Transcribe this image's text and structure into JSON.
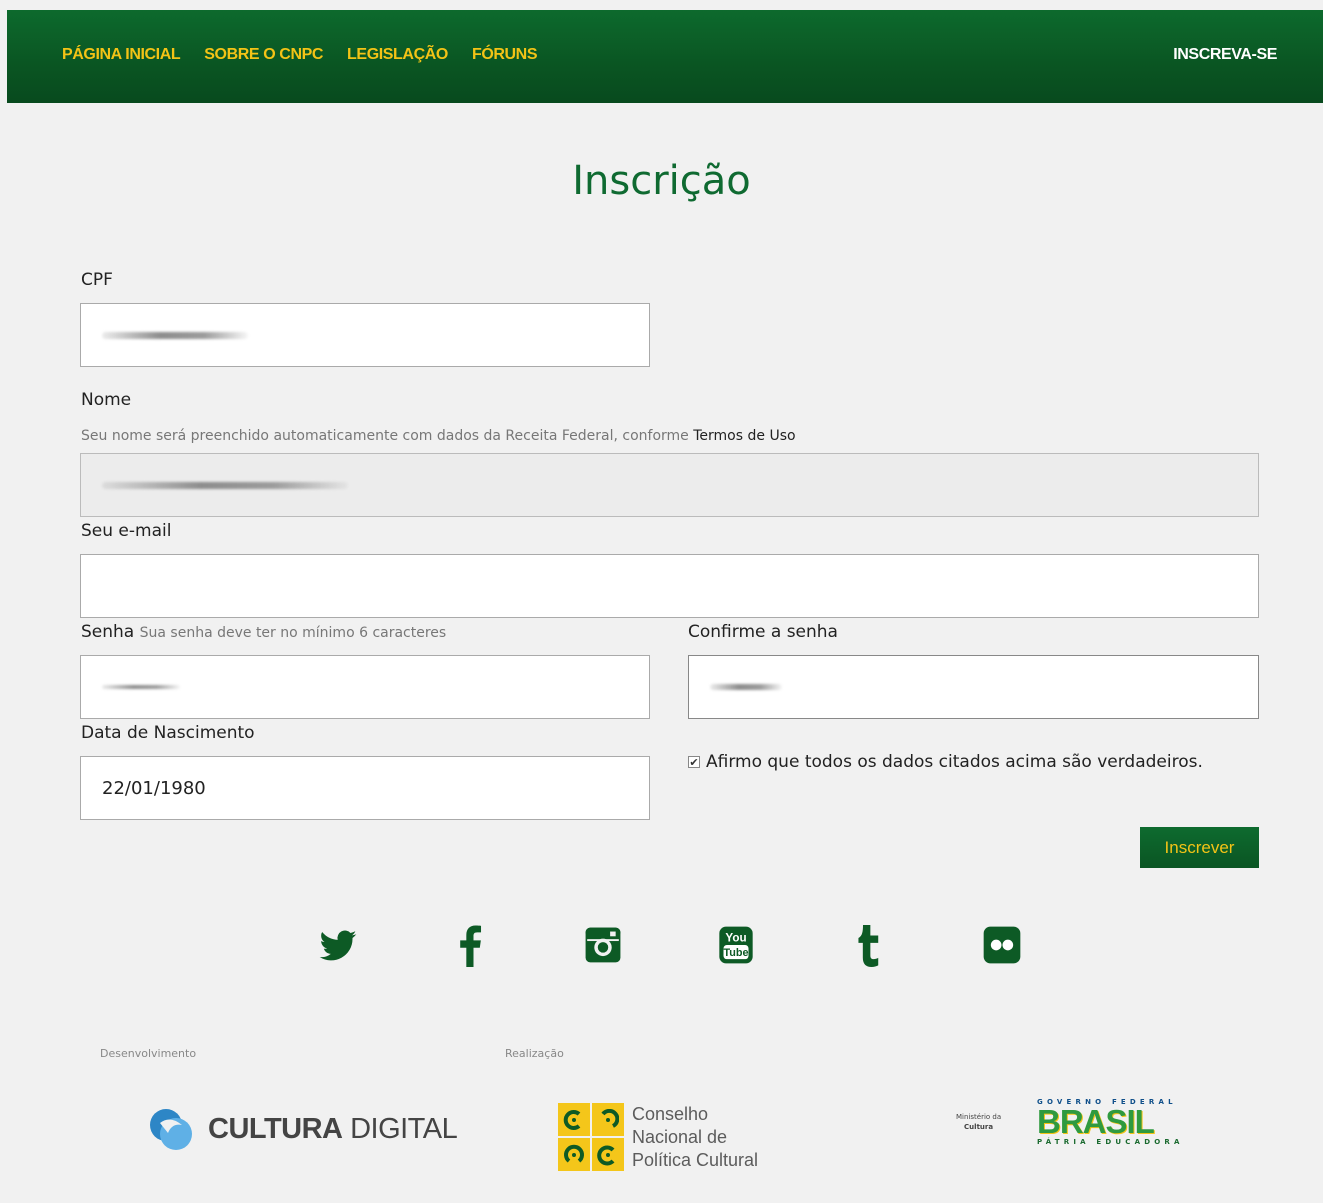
{
  "nav": {
    "items": [
      "PÁGINA INICIAL",
      "SOBRE O CNPC",
      "LEGISLAÇÃO",
      "FÓRUNS"
    ],
    "signup_label": "INSCREVA-SE"
  },
  "page": {
    "title": "Inscrição"
  },
  "form": {
    "cpf": {
      "label": "CPF",
      "value": "[redacted]"
    },
    "nome": {
      "label": "Nome",
      "hint": "Seu nome será preenchido automaticamente com dados da Receita Federal, conforme",
      "hint_link": "Termos de Uso",
      "value": "[redacted]"
    },
    "email": {
      "label": "Seu e-mail",
      "value": ""
    },
    "senha": {
      "label": "Senha",
      "hint": "Sua senha deve ter no mínimo 6 caracteres",
      "value": "[redacted]"
    },
    "confirm": {
      "label": "Confirme a senha",
      "value": "[redacted]"
    },
    "nascimento": {
      "label": "Data de Nascimento",
      "value": "22/01/1980"
    },
    "declaration": {
      "label": "Afirmo que todos os dados citados acima são verdadeiros.",
      "checked": true
    },
    "submit_label": "Inscrever"
  },
  "social": {
    "icons": [
      "twitter-icon",
      "facebook-icon",
      "instagram-icon",
      "youtube-icon",
      "tumblr-icon",
      "flickr-icon"
    ],
    "youtube_text_top": "You",
    "youtube_text_bottom": "Tube",
    "color": "#0d5a25"
  },
  "footer": {
    "dev_label": "Desenvolvimento",
    "real_label": "Realização",
    "cultura_digital": {
      "bold": "CULTURA",
      "regular": "DIGITAL"
    },
    "cnpc_lines": [
      "Conselho",
      "Nacional de",
      "Política Cultural"
    ],
    "minc_line1": "Ministério da",
    "minc_line2": "Cultura",
    "brasil_top": "GOVERNO FEDERAL",
    "brasil_word": "BRASIL",
    "brasil_bottom": "PÁTRIA EDUCADORA"
  },
  "colors": {
    "brand_green": "#0a5a25",
    "accent_yellow": "#f3c316"
  }
}
